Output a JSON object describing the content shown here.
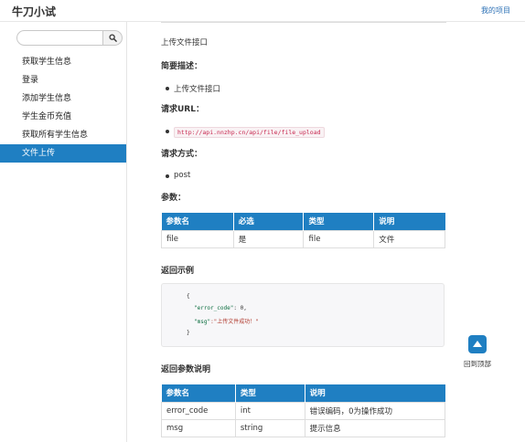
{
  "header": {
    "title": "牛刀小试",
    "right_link": "我的项目"
  },
  "sidebar": {
    "search": {
      "placeholder": "",
      "value": ""
    },
    "items": [
      {
        "label": "获取学生信息"
      },
      {
        "label": "登录"
      },
      {
        "label": "添加学生信息"
      },
      {
        "label": "学生金币充值"
      },
      {
        "label": "获取所有学生信息"
      },
      {
        "label": "文件上传",
        "active": true
      }
    ]
  },
  "doc": {
    "intro": "上传文件接口",
    "summary_heading": "简要描述：",
    "summary_item": "上传文件接口",
    "url_heading": "请求URL：",
    "url": "http://api.nnzhp.cn/api/file/file_upload",
    "method_heading": "请求方式：",
    "method": "post",
    "params_heading": "参数：",
    "params_table": {
      "headers": [
        "参数名",
        "必选",
        "类型",
        "说明"
      ],
      "rows": [
        [
          "file",
          "是",
          "file",
          "文件"
        ]
      ]
    },
    "example_heading": "返回示例",
    "example_code": {
      "open": "{",
      "line1_key": "\"error_code\"",
      "line1_rest": ": 0,",
      "line2_key": "\"msg\"",
      "line2_rest": ":\"上传文件成功！\"",
      "close": "}"
    },
    "return_heading": "返回参数说明",
    "return_table": {
      "headers": [
        "参数名",
        "类型",
        "说明"
      ],
      "rows": [
        [
          "error_code",
          "int",
          "错误编码，0为操作成功"
        ],
        [
          "msg",
          "string",
          "提示信息"
        ]
      ]
    }
  },
  "back_to_top": {
    "label": "回到顶部",
    "icon": "arrow-up-icon"
  },
  "colors": {
    "accent": "#1f7fc2",
    "link": "#2a6fb5",
    "code": "#c7254e"
  }
}
